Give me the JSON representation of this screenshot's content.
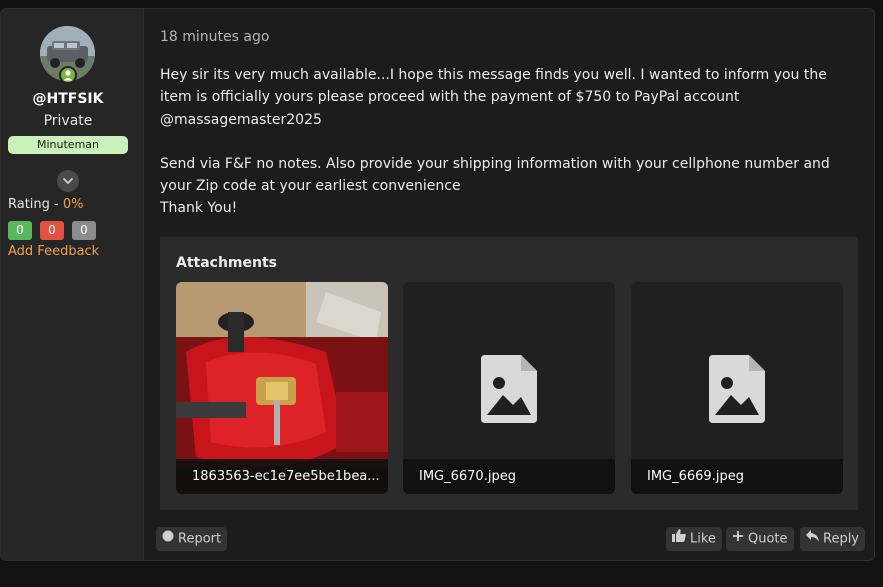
{
  "user": {
    "username": "@HTFSIK",
    "title": "Private",
    "rank": "Minuteman",
    "rating_label": "Rating - ",
    "rating_value": "0%",
    "feedback_positive": "0",
    "feedback_negative": "0",
    "feedback_neutral": "0",
    "add_feedback": "Add Feedback"
  },
  "post": {
    "timestamp": "18 minutes ago",
    "message_p1": "Hey sir its very much available...I hope this message finds you well. I wanted to inform you the item is officially yours please proceed with the payment of $750 to PayPal account @massagemaster2025",
    "message_p2": "Send via F&F no notes. Also provide your shipping information with your cellphone number and your Zip code at your earliest convenience",
    "message_p3": "Thank You!"
  },
  "attachments": {
    "title": "Attachments",
    "files": [
      {
        "name": "1863563-ec1e7ee5be1bea...",
        "icon": "photo-thumbnail"
      },
      {
        "name": "IMG_6670.jpeg",
        "icon": "image-placeholder-icon"
      },
      {
        "name": "IMG_6669.jpeg",
        "icon": "image-placeholder-icon"
      }
    ]
  },
  "actions": {
    "report": "Report",
    "like": "Like",
    "quote": "Quote",
    "reply": "Reply"
  },
  "colors": {
    "accent": "#f0a04b",
    "online": "#7cb342",
    "rank_badge": "#c9f0b8",
    "positive": "#5cb85c",
    "negative": "#e25241",
    "neutral": "#8c8c8c"
  }
}
